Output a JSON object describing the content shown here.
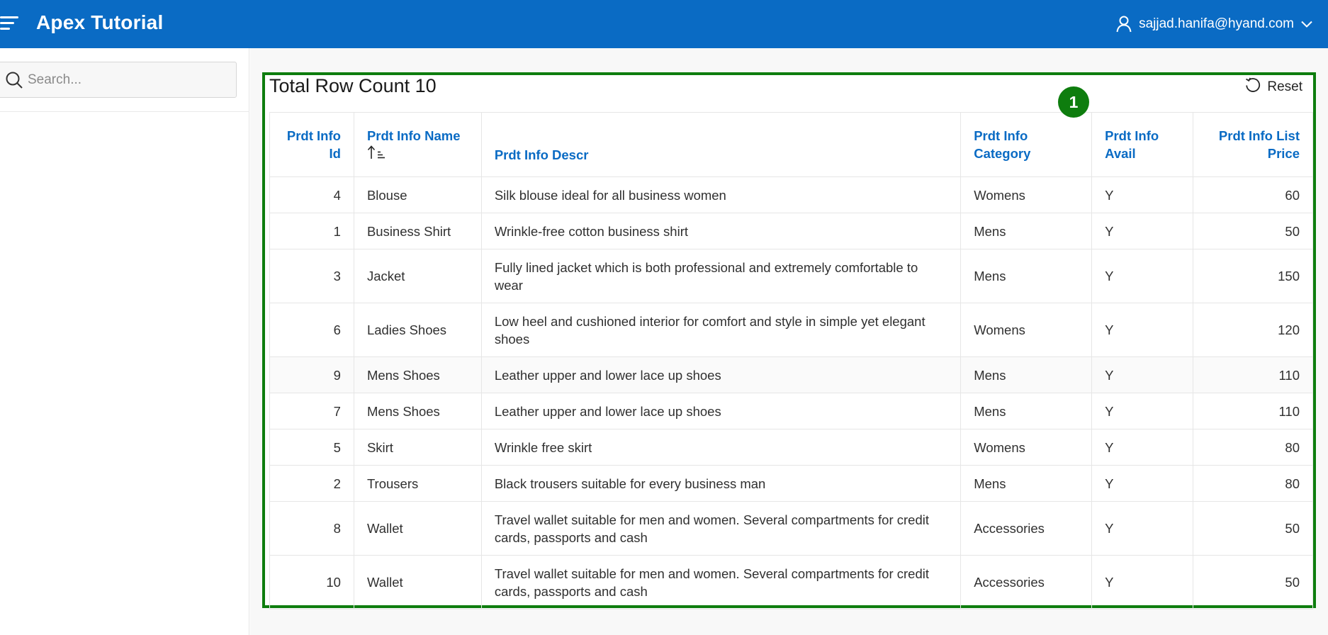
{
  "header": {
    "app_title": "Apex Tutorial",
    "user_email": "sajjad.hanifa@hyand.com",
    "accent_color": "#0a6bc4"
  },
  "sidebar": {
    "search_placeholder": "Search..."
  },
  "region": {
    "badge_number": "1",
    "title": "Total Row Count 10",
    "reset_label": "Reset",
    "highlight_color": "#0e7d0e"
  },
  "table": {
    "columns": [
      {
        "label": "Prdt Info Id"
      },
      {
        "label": "Prdt Info Name"
      },
      {
        "label": "Prdt Info Descr"
      },
      {
        "label": "Prdt Info Category"
      },
      {
        "label": "Prdt Info Avail"
      },
      {
        "label": "Prdt Info List Price"
      }
    ],
    "sort_column": "Prdt Info Name",
    "sort_direction": "ascending",
    "rows": [
      {
        "id": "4",
        "name": "Blouse",
        "descr": "Silk blouse ideal for all business women",
        "category": "Womens",
        "avail": "Y",
        "price": "60"
      },
      {
        "id": "1",
        "name": "Business Shirt",
        "descr": "Wrinkle-free cotton business shirt",
        "category": "Mens",
        "avail": "Y",
        "price": "50"
      },
      {
        "id": "3",
        "name": "Jacket",
        "descr": "Fully lined jacket which is both professional and extremely comfortable to wear",
        "category": "Mens",
        "avail": "Y",
        "price": "150"
      },
      {
        "id": "6",
        "name": "Ladies Shoes",
        "descr": "Low heel and cushioned interior for comfort and style in simple yet elegant shoes",
        "category": "Womens",
        "avail": "Y",
        "price": "120"
      },
      {
        "id": "9",
        "name": "Mens Shoes",
        "descr": "Leather upper and lower lace up shoes",
        "category": "Mens",
        "avail": "Y",
        "price": "110"
      },
      {
        "id": "7",
        "name": "Mens Shoes",
        "descr": "Leather upper and lower lace up shoes",
        "category": "Mens",
        "avail": "Y",
        "price": "110"
      },
      {
        "id": "5",
        "name": "Skirt",
        "descr": "Wrinkle free skirt",
        "category": "Womens",
        "avail": "Y",
        "price": "80"
      },
      {
        "id": "2",
        "name": "Trousers",
        "descr": "Black trousers suitable for every business man",
        "category": "Mens",
        "avail": "Y",
        "price": "80"
      },
      {
        "id": "8",
        "name": "Wallet",
        "descr": "Travel wallet suitable for men and women. Several compartments for credit cards, passports and cash",
        "category": "Accessories",
        "avail": "Y",
        "price": "50"
      },
      {
        "id": "10",
        "name": "Wallet",
        "descr": "Travel wallet suitable for men and women. Several compartments for credit cards, passports and cash",
        "category": "Accessories",
        "avail": "Y",
        "price": "50"
      }
    ]
  },
  "icons": {
    "menu": "hamburger-icon",
    "user": "user-icon",
    "dropdown": "chevron-down-icon",
    "search": "search-icon",
    "reset": "reset-icon",
    "sort": "sort-ascending-icon"
  }
}
